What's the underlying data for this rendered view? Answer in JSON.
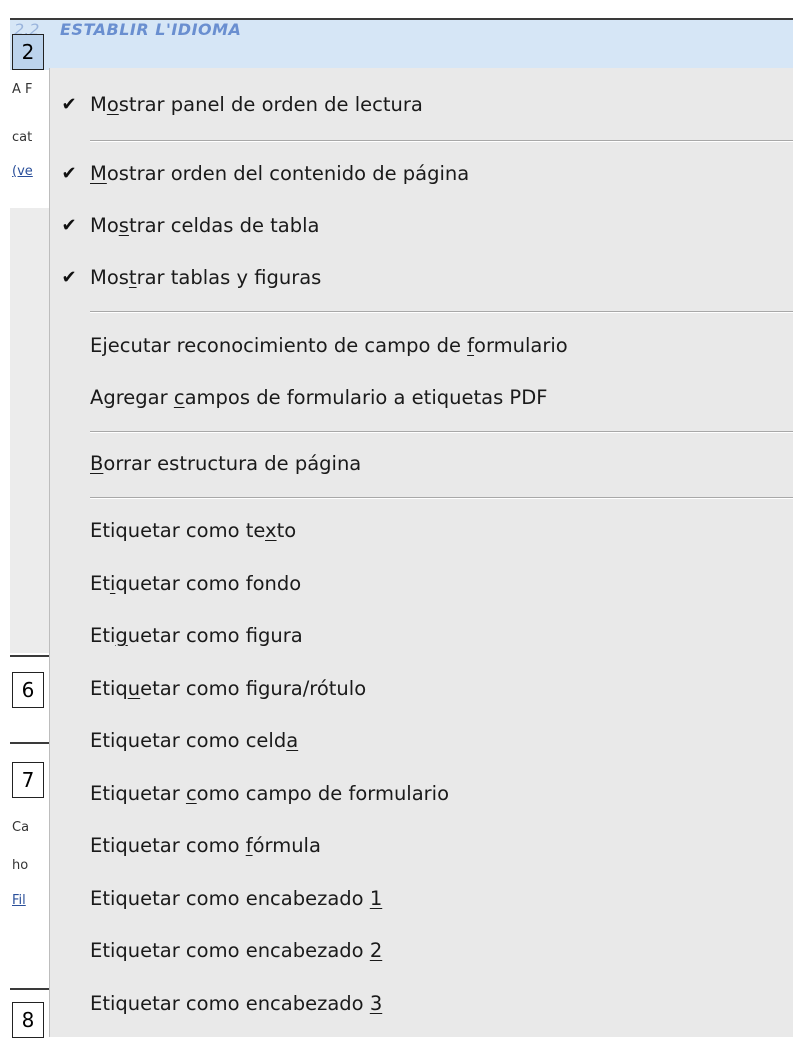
{
  "document": {
    "header_prefix": "2.2",
    "header_title": "ESTABLIR L'IDIOMA",
    "side_text_1": "A F",
    "side_text_2": "cat",
    "side_text_3": "(ve",
    "side_text_4": "Ca",
    "side_text_5": "ho",
    "side_text_6": "Fil",
    "numbers": [
      "2",
      "6",
      "7",
      "8"
    ]
  },
  "menu": {
    "items": [
      {
        "pre": "M",
        "mn": "o",
        "post": "strar panel de orden de lectura",
        "checked": true,
        "check_glyph": "✔"
      },
      {
        "pre": "",
        "mn": "M",
        "post": "ostrar orden del contenido de página",
        "checked": true,
        "check_glyph": "✔"
      },
      {
        "pre": "Mo",
        "mn": "s",
        "post": "trar celdas de tabla",
        "checked": true,
        "check_glyph": "✔"
      },
      {
        "pre": "Mos",
        "mn": "t",
        "post": "rar tablas y figuras",
        "checked": true,
        "check_glyph": "✔"
      },
      {
        "pre": "Ejecutar reconocimiento de campo de ",
        "mn": "f",
        "post": "ormulario",
        "checked": false
      },
      {
        "pre": "Agregar ",
        "mn": "c",
        "post": "ampos de formulario a etiquetas PDF",
        "checked": false
      },
      {
        "pre": "",
        "mn": "B",
        "post": "orrar estructura de página",
        "checked": false
      },
      {
        "pre": "Etiquetar como te",
        "mn": "x",
        "post": "to",
        "checked": false
      },
      {
        "pre": "Et",
        "mn": "i",
        "post": "quetar como fondo",
        "checked": false
      },
      {
        "pre": "Eti",
        "mn": "g",
        "post": "uetar como figura",
        "checked": false
      },
      {
        "pre": "Etiq",
        "mn": "u",
        "post": "etar como figura/rótulo",
        "checked": false
      },
      {
        "pre": "Etiquetar como celd",
        "mn": "a",
        "post": "",
        "checked": false
      },
      {
        "pre": "Etiquetar ",
        "mn": "c",
        "post": "omo campo de formulario",
        "checked": false
      },
      {
        "pre": "Etiquetar como ",
        "mn": "f",
        "post": "órmula",
        "checked": false
      },
      {
        "pre": "Etiquetar como encabezado ",
        "mn": "1",
        "post": "",
        "checked": false
      },
      {
        "pre": "Etiquetar como encabezado ",
        "mn": "2",
        "post": "",
        "checked": false
      },
      {
        "pre": "Etiquetar como encabezado ",
        "mn": "3",
        "post": "",
        "checked": false
      }
    ]
  }
}
